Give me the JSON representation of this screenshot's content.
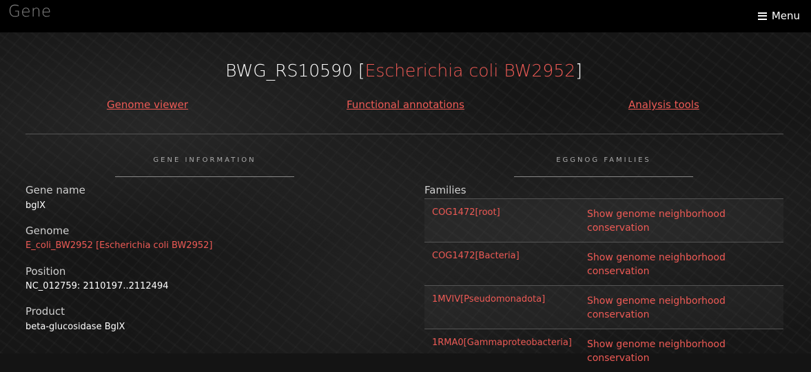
{
  "header": {
    "app_title": "Gene",
    "menu_label": "Menu"
  },
  "page": {
    "gene_id": "BWG_RS10590",
    "organism": "Escherichia coli BW2952",
    "bracket_open": "[",
    "bracket_close": "]"
  },
  "nav": [
    "Genome viewer",
    "Functional annotations",
    "Analysis tools"
  ],
  "gene_info": {
    "heading": "GENE INFORMATION",
    "fields": [
      {
        "label": "Gene name",
        "value": "bglX"
      },
      {
        "label": "Genome",
        "value": "E_coli_BW2952 [Escherichia coli BW2952]"
      },
      {
        "label": "Position",
        "value": "NC_012759: 2110197..2112494"
      },
      {
        "label": "Product",
        "value": "beta-glucosidase BglX"
      }
    ]
  },
  "eggnog": {
    "heading": "EGGNOG FAMILIES",
    "families_label": "Families",
    "rows": [
      {
        "name": "COG1472[root]",
        "action": "Show genome neighborhood conservation"
      },
      {
        "name": "COG1472[Bacteria]",
        "action": "Show genome neighborhood conservation"
      },
      {
        "name": "1MVIV[Pseudomonadota]",
        "action": "Show genome neighborhood conservation"
      },
      {
        "name": "1RMA0[Gammaproteobacteria]",
        "action": "Show genome neighborhood conservation"
      }
    ]
  },
  "colors": {
    "accent": "#ee5a55",
    "topbar": "#000000",
    "background": "#161616"
  },
  "icons": {
    "menu": "hamburger-icon"
  }
}
